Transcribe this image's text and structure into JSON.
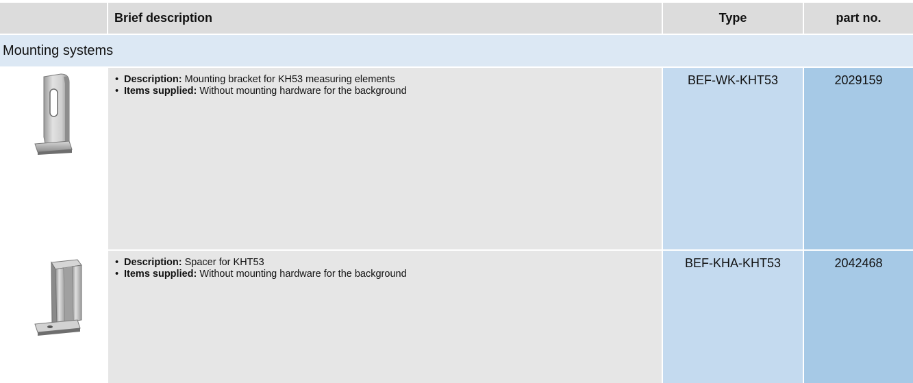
{
  "header": {
    "brief_description": "Brief description",
    "type": "Type",
    "part_no": "part no."
  },
  "section": {
    "title": "Mounting systems"
  },
  "rows": [
    {
      "image_icon": "mounting-bracket-photo",
      "bullets": [
        {
          "label": "Description:",
          "text": " Mounting bracket for KH53 measuring elements"
        },
        {
          "label": "Items supplied:",
          "text": " Without mounting hardware for the background"
        }
      ],
      "type": "BEF-WK-KHT53",
      "part_no": "2029159"
    },
    {
      "image_icon": "spacer-photo",
      "bullets": [
        {
          "label": "Description:",
          "text": " Spacer for KHT53"
        },
        {
          "label": "Items supplied:",
          "text": " Without mounting hardware for the background"
        }
      ],
      "type": "BEF-KHA-KHT53",
      "part_no": "2042468"
    }
  ],
  "colors": {
    "header_bg": "#dcdcdc",
    "section_bg": "#dce8f4",
    "desc_bg": "#e6e6e6",
    "type_bg": "#c4daef",
    "part_bg": "#a6c9e6"
  }
}
